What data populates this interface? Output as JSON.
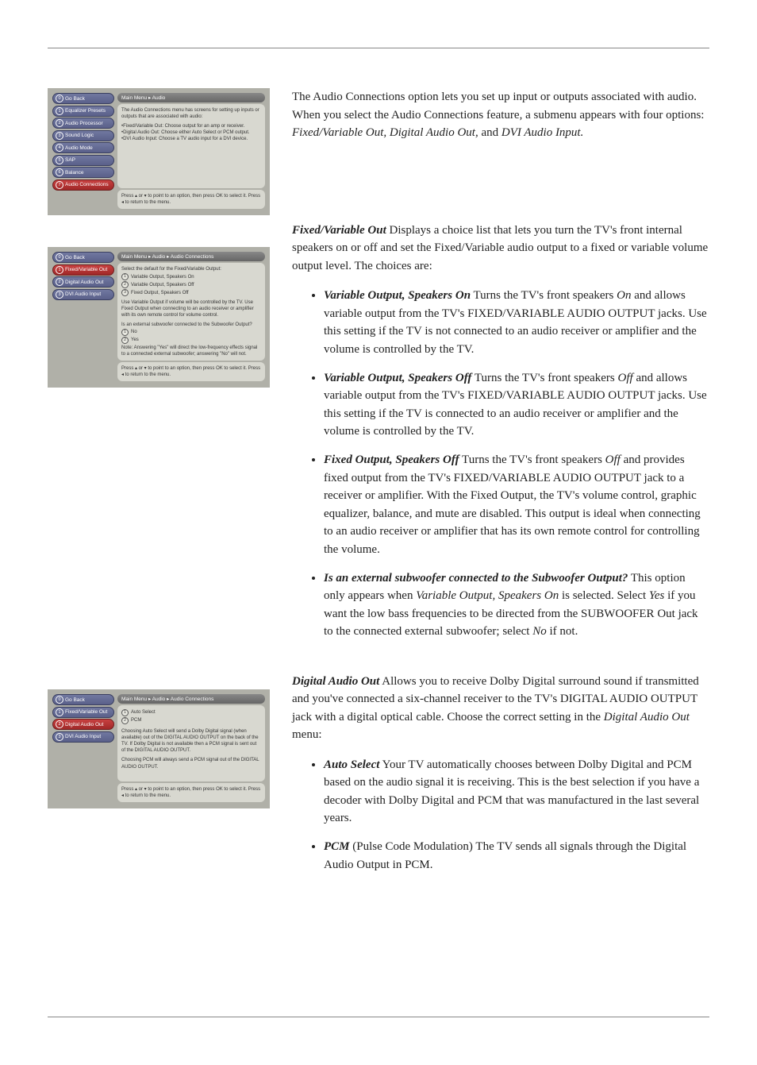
{
  "menu1": {
    "breadcrumb": "Main Menu ▸ Audio",
    "items": [
      {
        "n": "0",
        "label": "Go Back"
      },
      {
        "n": "1",
        "label": "Equalizer Presets"
      },
      {
        "n": "2",
        "label": "Audio Processor"
      },
      {
        "n": "3",
        "label": "Sound Logic"
      },
      {
        "n": "4",
        "label": "Audio Mode"
      },
      {
        "n": "5",
        "label": "SAP"
      },
      {
        "n": "6",
        "label": "Balance"
      },
      {
        "n": "7",
        "label": "Audio Connections"
      }
    ],
    "desc_intro": "The Audio Connections menu has screens for setting up inputs or outputs that are associated with audio:",
    "desc_b1": "•Fixed/Variable Out: Choose output for an amp or receiver.",
    "desc_b2": "•Digital Audio Out: Choose either Auto Select or PCM output.",
    "desc_b3": "•DVI Audio Input: Choose a TV audio input for a DVI device.",
    "footer": "Press ▴ or ▾ to point to an option, then press OK to select it. Press ◂ to return to the menu."
  },
  "menu2": {
    "breadcrumb": "Main Menu ▸ Audio ▸ Audio Connections",
    "items": [
      {
        "n": "0",
        "label": "Go Back"
      },
      {
        "n": "1",
        "label": "Fixed/Variable Out"
      },
      {
        "n": "2",
        "label": "Digital Audio Out"
      },
      {
        "n": "3",
        "label": "DVI Audio Input"
      }
    ],
    "desc_head": "Select the default for the Fixed/Variable Output:",
    "r1": "Variable Output, Speakers On",
    "r2": "Variable Output, Speakers Off",
    "r3": "Fixed Output, Speakers Off",
    "desc_p1": "Use Variable Output if volume will be controlled by the TV. Use Fixed Output when connecting to an audio receiver or amplifier with its own remote control for volume control.",
    "desc_q": "Is an external subwoofer connected to the Subwoofer Output?",
    "q_no": "No",
    "q_yes": "Yes",
    "note": "Note: Answering \"Yes\" will direct the low-frequency effects signal to a connected external subwoofer; answering \"No\" will not.",
    "footer": "Press ▴ or ▾ to point to an option, then press OK to select it. Press ◂ to return to the menu."
  },
  "menu3": {
    "breadcrumb": "Main Menu ▸ Audio ▸ Audio Connections",
    "items": [
      {
        "n": "0",
        "label": "Go Back"
      },
      {
        "n": "1",
        "label": "Fixed/Variable Out"
      },
      {
        "n": "2",
        "label": "Digital Audio Out"
      },
      {
        "n": "3",
        "label": "DVI Audio Input"
      }
    ],
    "r1": "Auto Select",
    "r2": "PCM",
    "desc_p1": "Choosing Auto Select will send a Dolby Digital signal (when available) out of the DIGITAL AUDIO OUTPUT on the back of the TV. If Dolby Digital is not available then a PCM signal is sent out of the DIGITAL AUDIO OUTPUT.",
    "desc_p2": "Choosing PCM will always send a PCM signal out of the DIGITAL AUDIO OUTPUT.",
    "footer": "Press ▴ or ▾ to point to an option, then press OK to select it. Press ◂ to return to the menu."
  },
  "text": {
    "intro_a": "The Audio Connections option lets you set up input or outputs associated with audio. When you select the Audio Connections feature, a submenu appears with four options: ",
    "intro_ital1": "Fixed/Variable Out, Digital Audio Out,",
    "intro_mid": " and ",
    "intro_ital2": "DVI Audio Input.",
    "fvo_head": "Fixed/Variable Out",
    "fvo_body": "   Displays a choice list that lets you turn the TV's front internal speakers on or off and set the Fixed/Variable audio output to a fixed or variable volume output level. The choices are:",
    "b1_head": "Variable Output, Speakers On",
    "b1_a": "   Turns the TV's front speakers ",
    "b1_on": "On",
    "b1_b": " and allows variable output from the TV's FIXED/VARIABLE AUDIO OUTPUT jacks. Use this setting if the TV is not connected to an audio receiver or amplifier and the volume is controlled by the TV.",
    "b2_head": "Variable Output, Speakers Off",
    "b2_a": "   Turns the TV's front speakers ",
    "b2_off": "Off",
    "b2_b": " and allows variable output from the TV's FIXED/VARIABLE AUDIO OUTPUT jacks. Use this setting if the TV is connected to an audio receiver or amplifier and the volume is controlled by the TV.",
    "b3_head": "Fixed Output, Speakers Off",
    "b3_a": "   Turns the TV's front speakers ",
    "b3_off": "Off",
    "b3_b": " and provides fixed output from the TV's FIXED/VARIABLE AUDIO OUTPUT jack to a receiver or amplifier. With the Fixed Output, the TV's volume control, graphic equalizer, balance, and mute are disabled.  This output is ideal when connecting to an audio receiver or amplifier that has its own remote control for controlling the volume.",
    "b4_head": "Is an external subwoofer connected to the Subwoofer Output?",
    "b4_a": " This option only appears when ",
    "b4_i1": "Variable Output, Speakers On",
    "b4_b": " is selected. Select ",
    "b4_i2": "Yes",
    "b4_c": " if you want the low bass frequencies to be directed from the SUBWOOFER Out jack to the connected external subwoofer; select ",
    "b4_i3": "No",
    "b4_d": " if not.",
    "dao_head": "Digital Audio Out",
    "dao_a": "   Allows you to receive Dolby Digital surround sound if transmitted and you've connected a six-channel receiver to the TV's DIGITAL AUDIO OUTPUT jack with a digital optical cable. Choose the correct setting in the ",
    "dao_ital": "Digital Audio Out",
    "dao_b": " menu:",
    "d1_head": "Auto Select",
    "d1_body": "   Your TV automatically chooses between Dolby Digital and PCM based on the audio signal it is receiving. This is the best selection if you have a decoder with Dolby Digital and PCM that was manufactured in the last several years.",
    "d2_head": "PCM",
    "d2_body": " (Pulse Code Modulation)   The TV sends all signals through the Digital Audio Output in PCM."
  }
}
